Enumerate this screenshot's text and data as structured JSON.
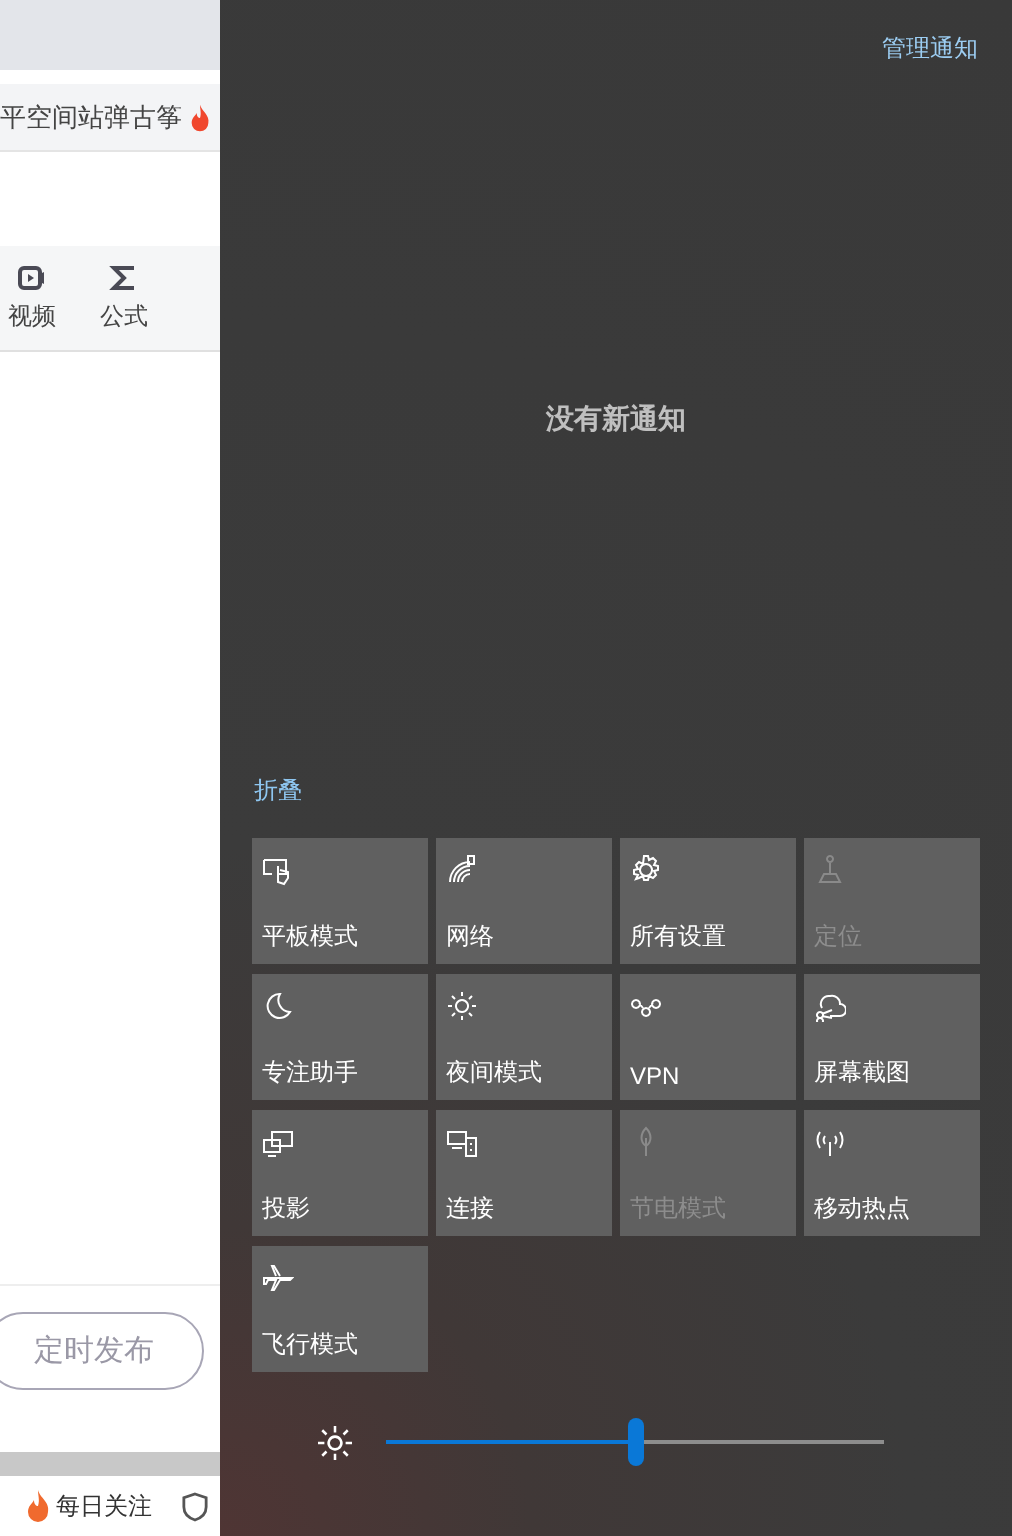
{
  "browser_page": {
    "bookmark_text": "平空间站弹古筝",
    "toolbar_items": [
      {
        "label": "视频"
      },
      {
        "label": "公式"
      }
    ],
    "schedule_button": "定时发布",
    "bottom_bar_item": "每日关注"
  },
  "action_center": {
    "manage_link": "管理通知",
    "empty_message": "没有新通知",
    "collapse_link": "折叠",
    "tiles": [
      {
        "label": "平板模式",
        "disabled": false
      },
      {
        "label": "网络",
        "disabled": false
      },
      {
        "label": "所有设置",
        "disabled": false
      },
      {
        "label": "定位",
        "disabled": true
      },
      {
        "label": "专注助手",
        "disabled": false
      },
      {
        "label": "夜间模式",
        "disabled": false
      },
      {
        "label": "VPN",
        "disabled": false
      },
      {
        "label": "屏幕截图",
        "disabled": false
      },
      {
        "label": "投影",
        "disabled": false
      },
      {
        "label": "连接",
        "disabled": false
      },
      {
        "label": "节电模式",
        "disabled": true
      },
      {
        "label": "移动热点",
        "disabled": false
      },
      {
        "label": "飞行模式",
        "disabled": false
      }
    ],
    "brightness": {
      "level": 0.5
    }
  }
}
